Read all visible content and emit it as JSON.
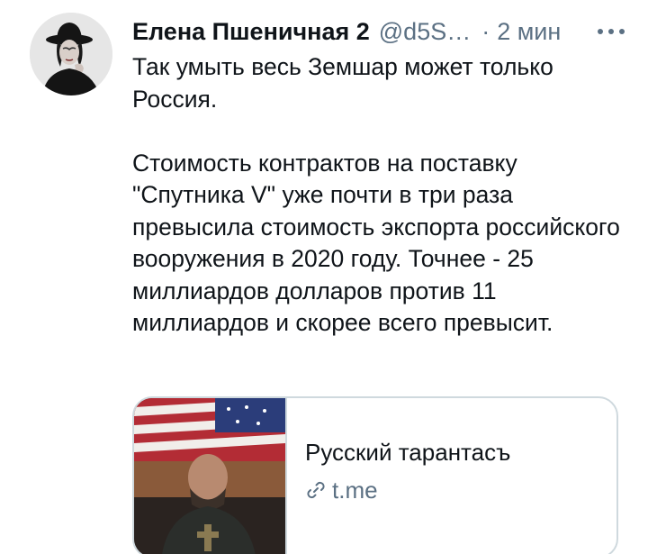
{
  "tweet": {
    "author": {
      "name": "Елена Пшеничная 2",
      "handle": "@d5S…",
      "separator": "·",
      "time": "2 мин"
    },
    "more_icon": "more-horizontal-icon",
    "text": {
      "p1": "Так умыть весь Земшар может только Россия.",
      "p2": "Стоимость контрактов на поставку \"Спутника V\" уже почти в три раза превысила стоимость экспорта российского вооружения в 2020 году. Точнее -  25 миллиардов долларов против 11 миллиардов и скорее всего превысит."
    },
    "card": {
      "title": "Русский тарантасъ",
      "domain": "t.me",
      "domain_icon": "link-icon"
    },
    "colors": {
      "text": "#0f1419",
      "secondary": "#5b7083",
      "border": "#cfd9de"
    }
  }
}
